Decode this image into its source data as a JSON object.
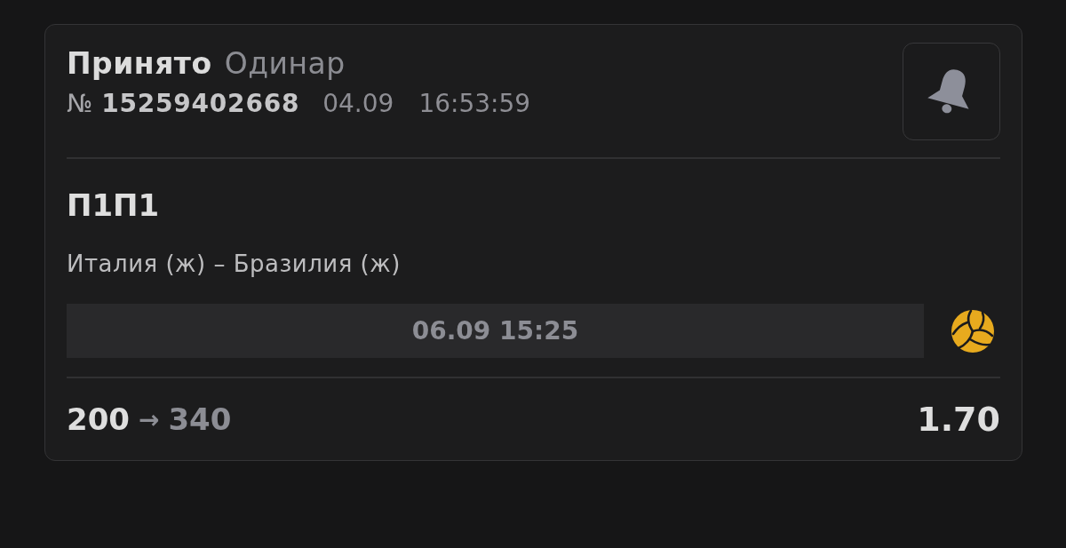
{
  "bet_card": {
    "status": "Принято",
    "bet_type": "Одинар",
    "number_sign": "№",
    "number": "15259402668",
    "date": "04.09",
    "time": "16:53:59",
    "selection": "П1П1",
    "event": "Италия (ж) – Бразилия (ж)",
    "event_start": "06.09 15:25",
    "stake": "200",
    "arrow": "→",
    "payout": "340",
    "odds": "1.70"
  }
}
